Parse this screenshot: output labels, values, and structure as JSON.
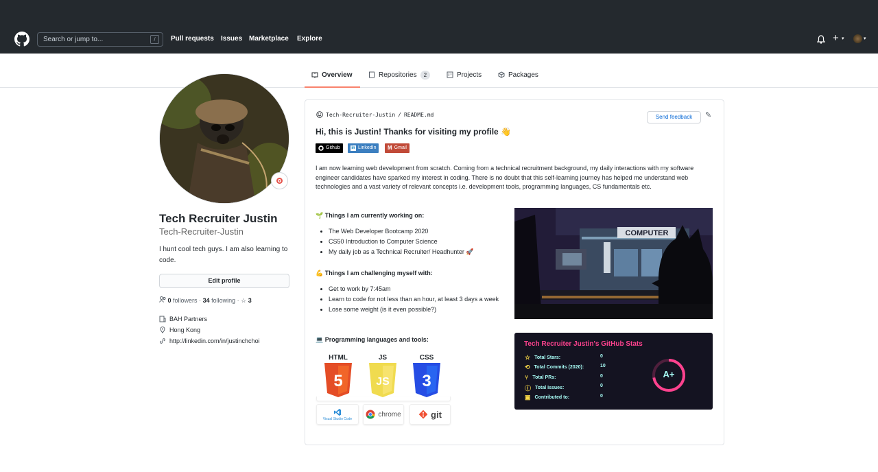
{
  "header": {
    "search_placeholder": "Search or jump to...",
    "search_key": "/",
    "nav": [
      "Pull requests",
      "Issues",
      "Marketplace",
      "Explore"
    ],
    "plus": "+",
    "caret": "▾"
  },
  "tabs": [
    {
      "label": "Overview",
      "active": true
    },
    {
      "label": "Repositories",
      "count": "2"
    },
    {
      "label": "Projects"
    },
    {
      "label": "Packages"
    }
  ],
  "profile": {
    "name": "Tech Recruiter Justin",
    "login": "Tech-Recruiter-Justin",
    "bio": "I hunt cool tech guys. I am also learning to code.",
    "edit_label": "Edit profile",
    "followers": "0",
    "followers_label": "followers",
    "following": "34",
    "following_label": "following",
    "stars": "3",
    "company": "BAH Partners",
    "location": "Hong Kong",
    "website": "http://linkedin.com/in/justinchchoi"
  },
  "readme": {
    "owner": "Tech-Recruiter-Justin",
    "sep": "/",
    "file": "README.md",
    "send_feedback": "Send feedback",
    "title": "Hi, this is Justin! Thanks for visiting my profile 👋",
    "badges": [
      {
        "label": "Github",
        "color": "#000000"
      },
      {
        "label": "LinkedIn",
        "color": "#0077b5"
      },
      {
        "label": "Gmail",
        "color": "#d14836"
      }
    ],
    "intro": "I am now learning web development from scratch. Coming from a technical recruitment background, my daily interactions with my software engineer candidates have sparked my interest in coding. There is no doubt that this self-learning journey has helped me understand web technologies and a vast variety of relevant concepts i.e. development tools, programming languages, CS fundamentals etc.",
    "working_heading": "🌱 Things I am currently working on:",
    "working": [
      "The Web Developer Bootcamp 2020",
      "CS50 Introduction to Computer Science",
      "My daily job as a Technical Recruiter/ Headhunter 🚀"
    ],
    "challenge_heading": "💪 Things I am challenging myself with:",
    "challenges": [
      "Get to work by 7:45am",
      "Learn to code for not less than an hour, at least 3 days a week",
      "Lose some weight (is it even possible?)"
    ],
    "tools_heading": "💻 Programming languages and tools:",
    "languages": [
      {
        "label": "HTML",
        "num": "5",
        "color": "#e44d26"
      },
      {
        "label": "JS",
        "num": "JS",
        "color": "#f0db4f"
      },
      {
        "label": "CSS",
        "num": "3",
        "color": "#264de4"
      }
    ],
    "tools": [
      "Visual Studio Code",
      "chrome",
      "git"
    ],
    "art_sign": "COMPUTER"
  },
  "stats": {
    "title": "Tech Recruiter Justin's GitHub Stats",
    "rows": [
      {
        "label": "Total Stars:",
        "value": "0"
      },
      {
        "label": "Total Commits (2020):",
        "value": "10"
      },
      {
        "label": "Total PRs:",
        "value": "0"
      },
      {
        "label": "Total Issues:",
        "value": "0"
      },
      {
        "label": "Contributed to:",
        "value": "0"
      }
    ],
    "grade": "A+"
  },
  "colors": {
    "header_bg": "#24292e",
    "tab_underline": "#f9826c",
    "link": "#0366d6",
    "stats_title": "#fe428e",
    "stats_text": "#a9fef7"
  }
}
